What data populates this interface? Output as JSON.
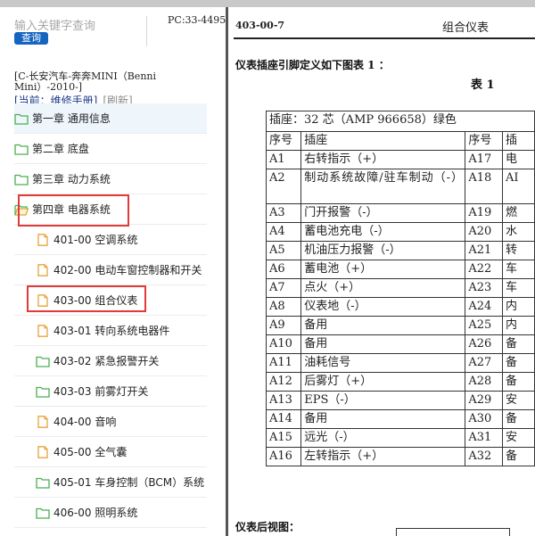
{
  "search": {
    "placeholder": "输入关键字查询",
    "button_label": "查询"
  },
  "pc_code": "PC:33-4495",
  "model": "[C-长安汽车-奔奔MINI（Benni Mini）-2010-]",
  "current": {
    "label": "[当前：维修手册]",
    "refresh_label": "[刷新]"
  },
  "tree": [
    {
      "label": "第一章 通用信息",
      "icon": "folder-icon"
    },
    {
      "label": "第二章 底盘",
      "icon": "folder-icon"
    },
    {
      "label": "第三章 动力系统",
      "icon": "folder-icon"
    },
    {
      "label": "第四章 电器系统",
      "icon": "folder-open-icon"
    },
    {
      "label": "401-00 空调系统",
      "icon": "document-icon"
    },
    {
      "label": "402-00 电动车窗控制器和开关",
      "icon": "document-icon"
    },
    {
      "label": "403-00 组合仪表",
      "icon": "document-icon"
    },
    {
      "label": "403-01 转向系统电器件",
      "icon": "document-icon"
    },
    {
      "label": "403-02 紧急报警开关",
      "icon": "folder-icon"
    },
    {
      "label": "403-03 前雾灯开关",
      "icon": "folder-icon"
    },
    {
      "label": "404-00 音响",
      "icon": "document-icon"
    },
    {
      "label": "405-00 全气囊",
      "icon": "document-icon"
    },
    {
      "label": "405-01 车身控制（BCM）系统",
      "icon": "folder-icon"
    },
    {
      "label": "406-00 照明系统",
      "icon": "folder-icon"
    }
  ],
  "colors": {
    "accent": "#1565c0",
    "highlight": "#e03a3a",
    "folder": "#4caf50",
    "document": "#e8a33a"
  },
  "document": {
    "code": "403-00-7",
    "title": "组合仪表",
    "intro": "仪表插座引脚定义如下图表 1 ：",
    "table_no": "表 1",
    "table": {
      "caption": "插座：32 芯（AMP 966658）绿色",
      "headers": [
        "序号",
        "插座",
        "序号",
        "插"
      ],
      "rows": [
        [
          "A1",
          "右转指示（+）",
          "A17",
          "电"
        ],
        [
          "A2",
          "制动系统故障/驻车制动（-）",
          "A18",
          "AI"
        ],
        [
          "A3",
          "门开报警（-）",
          "A19",
          "燃"
        ],
        [
          "A4",
          "蓄电池充电（-）",
          "A20",
          "水"
        ],
        [
          "A5",
          "机油压力报警（-）",
          "A21",
          "转"
        ],
        [
          "A6",
          "蓄电池（+）",
          "A22",
          "车"
        ],
        [
          "A7",
          "点火（+）",
          "A23",
          "车"
        ],
        [
          "A8",
          "仪表地（-）",
          "A24",
          "内"
        ],
        [
          "A9",
          "备用",
          "A25",
          "内"
        ],
        [
          "A10",
          "备用",
          "A26",
          "备"
        ],
        [
          "A11",
          "油耗信号",
          "A27",
          "备"
        ],
        [
          "A12",
          "后雾灯（+）",
          "A28",
          "备"
        ],
        [
          "A13",
          "EPS（-）",
          "A29",
          "安"
        ],
        [
          "A14",
          "备用",
          "A30",
          "备"
        ],
        [
          "A15",
          "远光（-）",
          "A31",
          "安"
        ],
        [
          "A16",
          "左转指示（+）",
          "A32",
          "备"
        ]
      ]
    },
    "rear_view_label": "仪表后视图："
  }
}
